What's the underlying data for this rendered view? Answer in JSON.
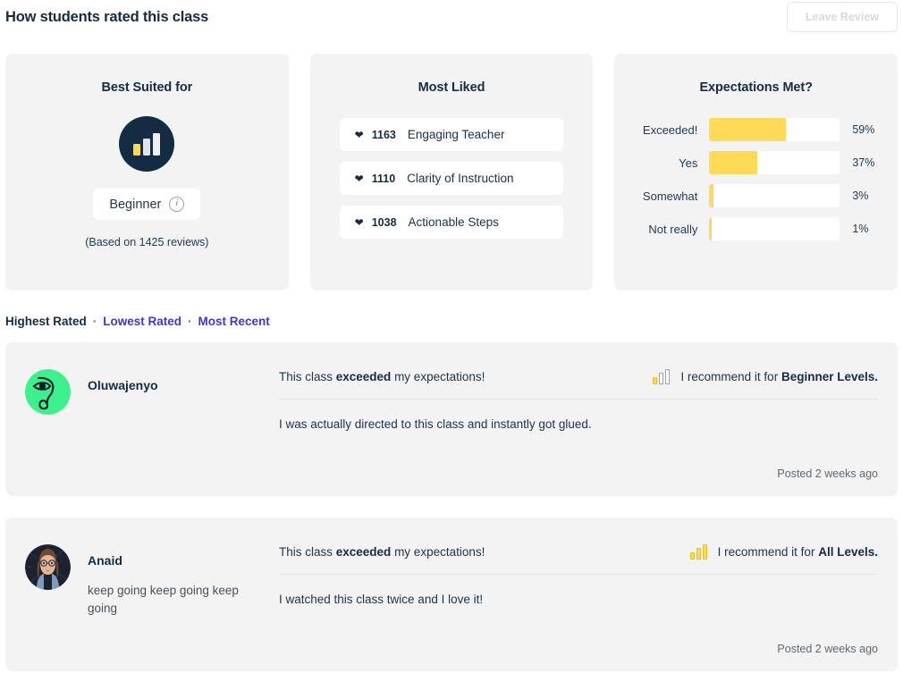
{
  "header": {
    "title": "How students rated this class",
    "leave_review_label": "Leave Review"
  },
  "cards": {
    "best_suited": {
      "title": "Best Suited for",
      "level": "Beginner",
      "info_icon": "info-icon",
      "based_on": "(Based on 1425 reviews)"
    },
    "most_liked": {
      "title": "Most Liked",
      "items": [
        {
          "count": "1163",
          "label": "Engaging Teacher",
          "icon": "heart-icon"
        },
        {
          "count": "1110",
          "label": "Clarity of Instruction",
          "icon": "heart-icon"
        },
        {
          "count": "1038",
          "label": "Actionable Steps",
          "icon": "heart-icon"
        }
      ]
    },
    "expectations": {
      "title": "Expectations Met?",
      "rows": [
        {
          "label": "Exceeded!",
          "pct": "59%",
          "value": 59
        },
        {
          "label": "Yes",
          "pct": "37%",
          "value": 37
        },
        {
          "label": "Somewhat",
          "pct": "3%",
          "value": 3
        },
        {
          "label": "Not really",
          "pct": "1%",
          "value": 1
        }
      ]
    }
  },
  "sortbar": {
    "active": "Highest Rated",
    "sep": "·",
    "links": [
      "Lowest Rated",
      "Most Recent"
    ]
  },
  "reviews": [
    {
      "name": "Oluwajenyo",
      "bio": "",
      "avatar_name": "avatar-oluwajenyo",
      "verdict_prefix": "This class ",
      "verdict_bold": "exceeded",
      "verdict_suffix": " my expectations!",
      "rec_prefix": "I recommend it for ",
      "rec_bold": "Beginner Levels.",
      "level_icon": "level-bars-beginner-icon",
      "level_filled": 1,
      "body": "I was actually directed to this class and instantly got glued.",
      "posted": "Posted 2 weeks ago"
    },
    {
      "name": "Anaid",
      "bio": "keep going keep going keep going",
      "avatar_name": "avatar-anaid",
      "verdict_prefix": "This class ",
      "verdict_bold": "exceeded",
      "verdict_suffix": " my expectations!",
      "rec_prefix": "I recommend it for ",
      "rec_bold": "All Levels.",
      "level_icon": "level-bars-all-levels-icon",
      "level_filled": 3,
      "body": "I watched this class twice and I love it!",
      "posted": "Posted 2 weeks ago"
    }
  ],
  "chart_data": {
    "type": "bar",
    "title": "Expectations Met?",
    "categories": [
      "Exceeded!",
      "Yes",
      "Somewhat",
      "Not really"
    ],
    "values": [
      59,
      37,
      3,
      1
    ],
    "xlabel": "",
    "ylabel": "",
    "xlim": [
      0,
      100
    ],
    "unit": "%",
    "orientation": "horizontal",
    "grid": false,
    "legend": "none",
    "bar_color": "#ffda56",
    "track_color": "#ffffff"
  },
  "colors": {
    "brand_navy": "#132c43",
    "accent_yellow": "#ffda56",
    "link_purple": "#4233d6",
    "card_bg": "#f3f3f3",
    "avatar_green": "#3cf08c"
  }
}
